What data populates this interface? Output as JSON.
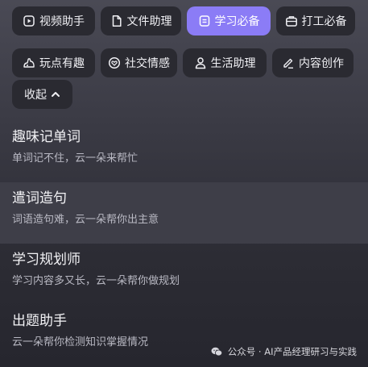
{
  "chips_row1": [
    {
      "label": "视频助手",
      "icon": "video-icon"
    },
    {
      "label": "文件助理",
      "icon": "document-icon"
    },
    {
      "label": "学习必备",
      "icon": "book-icon",
      "active": true
    },
    {
      "label": "打工必备",
      "icon": "briefcase-icon"
    }
  ],
  "chips_row2": [
    {
      "label": "玩点有趣",
      "icon": "game-icon"
    },
    {
      "label": "社交情感",
      "icon": "heart-icon"
    },
    {
      "label": "生活助理",
      "icon": "person-icon"
    },
    {
      "label": "内容创作",
      "icon": "pen-icon"
    }
  ],
  "collapse_label": "收起",
  "items": [
    {
      "title": "趣味记单词",
      "desc": "单词记不住，云一朵来帮忙"
    },
    {
      "title": "遣词造句",
      "desc": "词语造句难，云一朵帮你出主意"
    },
    {
      "title": "学习规划师",
      "desc": "学习内容多又长，云一朵帮你做规划"
    },
    {
      "title": "出题助手",
      "desc": "云一朵帮你检测知识掌握情况"
    }
  ],
  "watermark": "公众号 · AI产品经理研习与实践",
  "colors": {
    "accent": "#8b7cf6",
    "chip_bg": "#2a2a31",
    "highlight_bg": "#3e3e48"
  }
}
